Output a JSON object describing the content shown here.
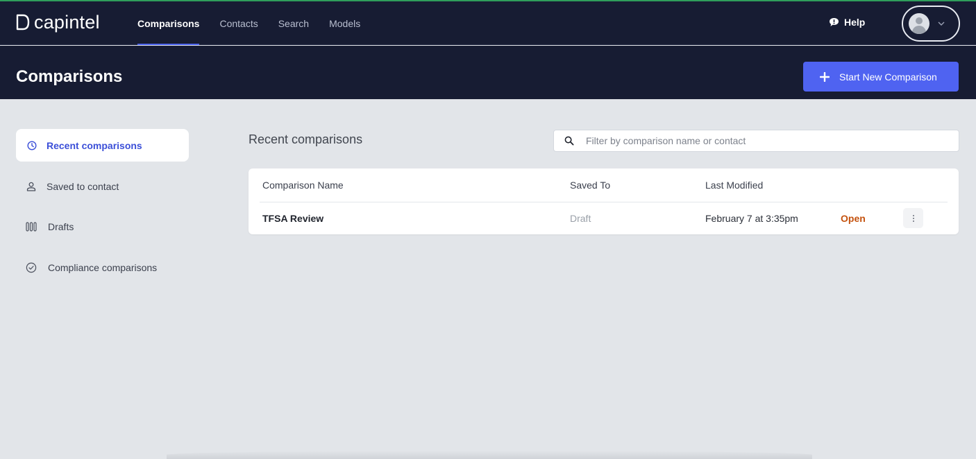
{
  "brand": {
    "name": "capintel"
  },
  "nav": {
    "links": [
      {
        "label": "Comparisons",
        "active": true
      },
      {
        "label": "Contacts",
        "active": false
      },
      {
        "label": "Search",
        "active": false
      },
      {
        "label": "Models",
        "active": false
      }
    ],
    "help_label": "Help"
  },
  "header": {
    "title": "Comparisons",
    "new_button_label": "Start New Comparison"
  },
  "sidebar": {
    "items": [
      {
        "label": "Recent comparisons",
        "icon": "clock-icon",
        "active": true
      },
      {
        "label": "Saved to contact",
        "icon": "person-icon",
        "active": false
      },
      {
        "label": "Drafts",
        "icon": "drafts-icon",
        "active": false
      },
      {
        "label": "Compliance comparisons",
        "icon": "check-circle-icon",
        "active": false
      }
    ]
  },
  "main": {
    "section_title": "Recent comparisons",
    "search": {
      "placeholder": "Filter by comparison name or contact",
      "value": ""
    },
    "table": {
      "columns": [
        "Comparison Name",
        "Saved To",
        "Last Modified"
      ],
      "rows": [
        {
          "name": "TFSA Review",
          "saved_to": "Draft",
          "last_modified": "February 7 at 3:35pm",
          "action": "Open"
        }
      ]
    }
  },
  "colors": {
    "nav_bg": "#171c33",
    "accent": "#4f63f1",
    "active_text": "#3b4fd8",
    "open_link": "#c4520e",
    "page_bg": "#e2e5e9"
  }
}
